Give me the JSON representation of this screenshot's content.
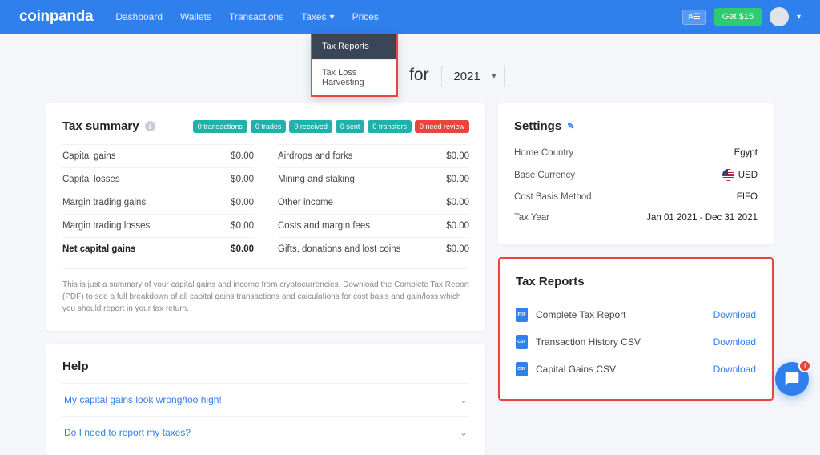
{
  "logo": "coinpanda",
  "nav": {
    "dashboard": "Dashboard",
    "wallets": "Wallets",
    "transactions": "Transactions",
    "taxes": "Taxes",
    "prices": "Prices"
  },
  "nav_right": {
    "translate": "A☰",
    "get": "Get $15"
  },
  "dropdown": {
    "tax_reports": "Tax Reports",
    "tax_loss": "Tax Loss Harvesting"
  },
  "page_title_suffix": " for",
  "year": "2021",
  "tax_summary": {
    "title": "Tax summary",
    "badges": {
      "transactions": "0 transactions",
      "trades": "0 trades",
      "received": "0 received",
      "sent": "0 sent",
      "transfers": "0 transfers",
      "need_review": "0 need review"
    },
    "rows_left": [
      {
        "label": "Capital gains",
        "value": "$0.00"
      },
      {
        "label": "Capital losses",
        "value": "$0.00"
      },
      {
        "label": "Margin trading gains",
        "value": "$0.00"
      },
      {
        "label": "Margin trading losses",
        "value": "$0.00"
      },
      {
        "label": "Net capital gains",
        "value": "$0.00"
      }
    ],
    "rows_right": [
      {
        "label": "Airdrops and forks",
        "value": "$0.00"
      },
      {
        "label": "Mining and staking",
        "value": "$0.00"
      },
      {
        "label": "Other income",
        "value": "$0.00"
      },
      {
        "label": "Costs and margin fees",
        "value": "$0.00"
      },
      {
        "label": "Gifts, donations and lost coins",
        "value": "$0.00"
      }
    ],
    "note": "This is just a summary of your capital gains and income from cryptocurrencies. Download the Complete Tax Report (PDF) to see a full breakdown of all capital gains transactions and calculations for cost basis and gain/loss which you should report in your tax return."
  },
  "settings": {
    "title": "Settings",
    "rows": [
      {
        "label": "Home Country",
        "value": "Egypt"
      },
      {
        "label": "Base Currency",
        "value": "USD",
        "flag": true
      },
      {
        "label": "Cost Basis Method",
        "value": "FIFO"
      },
      {
        "label": "Tax Year",
        "value": "Jan 01 2021 - Dec 31 2021"
      }
    ]
  },
  "reports": {
    "title": "Tax Reports",
    "items": [
      {
        "icon": "PDF",
        "label": "Complete Tax Report",
        "action": "Download"
      },
      {
        "icon": "CSV",
        "label": "Transaction History CSV",
        "action": "Download"
      },
      {
        "icon": "CSV",
        "label": "Capital Gains CSV",
        "action": "Download"
      }
    ]
  },
  "help": {
    "title": "Help",
    "items": [
      "My capital gains look wrong/too high!",
      "Do I need to report my taxes?"
    ]
  },
  "chat_badge": "1"
}
